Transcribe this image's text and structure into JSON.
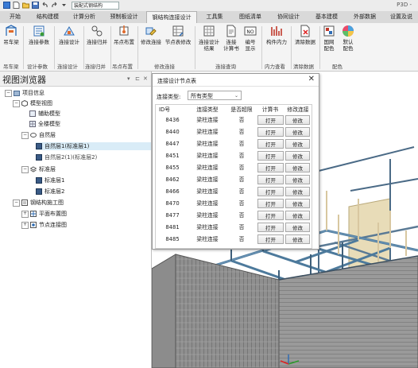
{
  "titlebar": {
    "combo_value": "装配式钢结构",
    "app_name": "P3D -"
  },
  "tabs": [
    {
      "label": "开始"
    },
    {
      "label": "结构建模"
    },
    {
      "label": "计算分析"
    },
    {
      "label": "预制板设计"
    },
    {
      "label": "钢结构连接设计"
    },
    {
      "label": "工具集"
    },
    {
      "label": "图纸清单"
    },
    {
      "label": "协同设计"
    },
    {
      "label": "基本建模"
    },
    {
      "label": "外部数据"
    },
    {
      "label": "设置及说"
    }
  ],
  "ribbon": {
    "buttons": [
      {
        "label": "吊车梁",
        "icon": "crane-beam-icon"
      },
      {
        "label": "连接参数",
        "icon": "connection-params-icon"
      },
      {
        "label": "连接设计",
        "icon": "connection-design-icon"
      },
      {
        "label": "连接归并",
        "icon": "connection-merge-icon"
      },
      {
        "label": "吊点布置",
        "icon": "lift-point-icon"
      },
      {
        "label": "修改连接",
        "icon": "edit-connection-icon"
      },
      {
        "label": "节点表修改",
        "icon": "node-table-icon"
      },
      {
        "label": "连接设计\n结果",
        "icon": "design-result-icon"
      },
      {
        "label": "连接\n计算书",
        "icon": "calc-book-icon"
      },
      {
        "label": "编号\n显示",
        "icon": "number-display-icon"
      },
      {
        "label": "构件内力",
        "icon": "member-force-icon"
      },
      {
        "label": "清除数据",
        "icon": "clear-data-icon"
      },
      {
        "label": "国网\n配色",
        "icon": "grid-color-icon"
      },
      {
        "label": "默认\n配色",
        "icon": "default-color-icon"
      }
    ],
    "groups": [
      {
        "label": "吊车梁"
      },
      {
        "label": "设计参数"
      },
      {
        "label": "连接设计"
      },
      {
        "label": "连接归并"
      },
      {
        "label": "吊点布置"
      },
      {
        "label": "修改连接"
      },
      {
        "label": "连接查询"
      },
      {
        "label": "内力查看"
      },
      {
        "label": "清除数据"
      },
      {
        "label": "配色"
      }
    ]
  },
  "left_panel": {
    "title": "视图浏览器",
    "tree": [
      {
        "label": "项目信息"
      },
      {
        "label": "模型视图"
      },
      {
        "label": "辅助模型"
      },
      {
        "label": "全楼模型"
      },
      {
        "label": "自然层"
      },
      {
        "label": "自然层1(标准层1)"
      },
      {
        "label": "自然层2(1)(标准层2)"
      },
      {
        "label": "标准层"
      },
      {
        "label": "标准层1"
      },
      {
        "label": "标准层2"
      },
      {
        "label": "钢结构施工图"
      },
      {
        "label": "平面布置图"
      },
      {
        "label": "节点连接图"
      }
    ]
  },
  "dialog": {
    "title": "连接设计节点表",
    "close": "✕",
    "type_label": "连接类型:",
    "type_value": "所有类型",
    "headers": [
      "ID号",
      "连接类型",
      "是否超限",
      "计算书",
      "修改连接"
    ],
    "rows": [
      {
        "id": "8436",
        "type": "梁柱连接",
        "over": "否",
        "calc": "打开",
        "edit": "修改"
      },
      {
        "id": "8440",
        "type": "梁柱连接",
        "over": "否",
        "calc": "打开",
        "edit": "修改"
      },
      {
        "id": "8447",
        "type": "梁柱连接",
        "over": "否",
        "calc": "打开",
        "edit": "修改"
      },
      {
        "id": "8451",
        "type": "梁柱连接",
        "over": "否",
        "calc": "打开",
        "edit": "修改"
      },
      {
        "id": "8455",
        "type": "梁柱连接",
        "over": "否",
        "calc": "打开",
        "edit": "修改"
      },
      {
        "id": "8462",
        "type": "梁柱连接",
        "over": "否",
        "calc": "打开",
        "edit": "修改"
      },
      {
        "id": "8466",
        "type": "梁柱连接",
        "over": "否",
        "calc": "打开",
        "edit": "修改"
      },
      {
        "id": "8470",
        "type": "梁柱连接",
        "over": "否",
        "calc": "打开",
        "edit": "修改"
      },
      {
        "id": "8477",
        "type": "梁柱连接",
        "over": "否",
        "calc": "打开",
        "edit": "修改"
      },
      {
        "id": "8481",
        "type": "梁柱连接",
        "over": "否",
        "calc": "打开",
        "edit": "修改"
      },
      {
        "id": "8485",
        "type": "梁柱连接",
        "over": "否",
        "calc": "打开",
        "edit": "修改"
      }
    ]
  }
}
